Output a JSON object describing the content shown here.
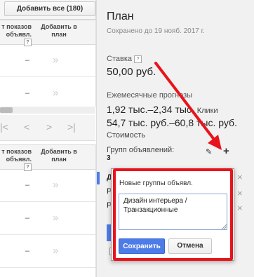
{
  "left": {
    "add_all_label": "Добавить все (180)",
    "col_impressions": "т показов",
    "col_impressions_2": "объявл.",
    "col_add": "Добавить в",
    "col_add_2": "план",
    "help_mark": "?",
    "dash": "–",
    "chevron": "»",
    "pager": [
      "|<",
      "<",
      ">",
      ">|"
    ]
  },
  "panel": {
    "title": "План",
    "saved": "Сохранено до 19 нояб. 2017 г.",
    "bid_label": "Ставка",
    "bid_value": "50,00 руб.",
    "monthly_label": "Ежемесячные прогнозы",
    "clicks_value": "1,92 тыс.–2,34 тыс.",
    "clicks_label": "Клики",
    "cost_value": "54,7 тыс. руб.–60,8 тыс. руб.",
    "cost_label": "Стоимость",
    "groups_label": "Групп объявлений:",
    "groups_count": "3",
    "list_letters": [
      "Д",
      "Р",
      "Р"
    ],
    "close_glyph": "×",
    "edit_glyph": "✎",
    "add_glyph": "+"
  },
  "popup": {
    "title": "Новые группы объявл.",
    "textarea_value": "Дизайн интерьера /\nТранзакционные",
    "save_label": "Сохранить",
    "cancel_label": "Отмена"
  },
  "colors": {
    "highlight": "#e8141b",
    "primary_button": "#4d7ce8",
    "panel_bg": "#f1f1f1"
  }
}
